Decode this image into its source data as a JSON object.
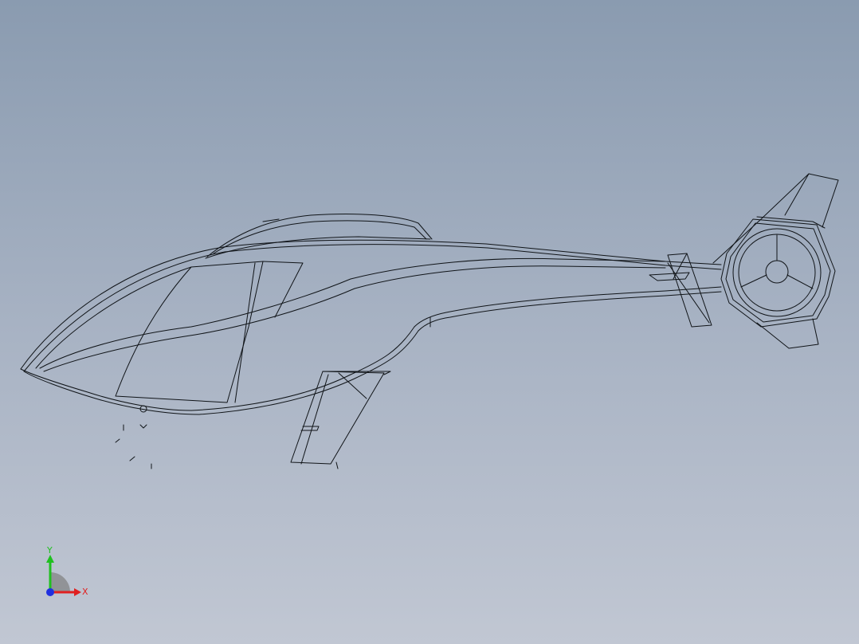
{
  "viewport": {
    "model_name": "helicopter-fuselage-wireframe"
  },
  "triad": {
    "x_label": "X",
    "y_label": "Y",
    "x_color": "#e02020",
    "y_color": "#20c020",
    "z_color": "#2030e0"
  },
  "colors": {
    "background_top": "#8a9bb0",
    "background_bottom": "#c1c7d3",
    "edge": "#101418"
  }
}
